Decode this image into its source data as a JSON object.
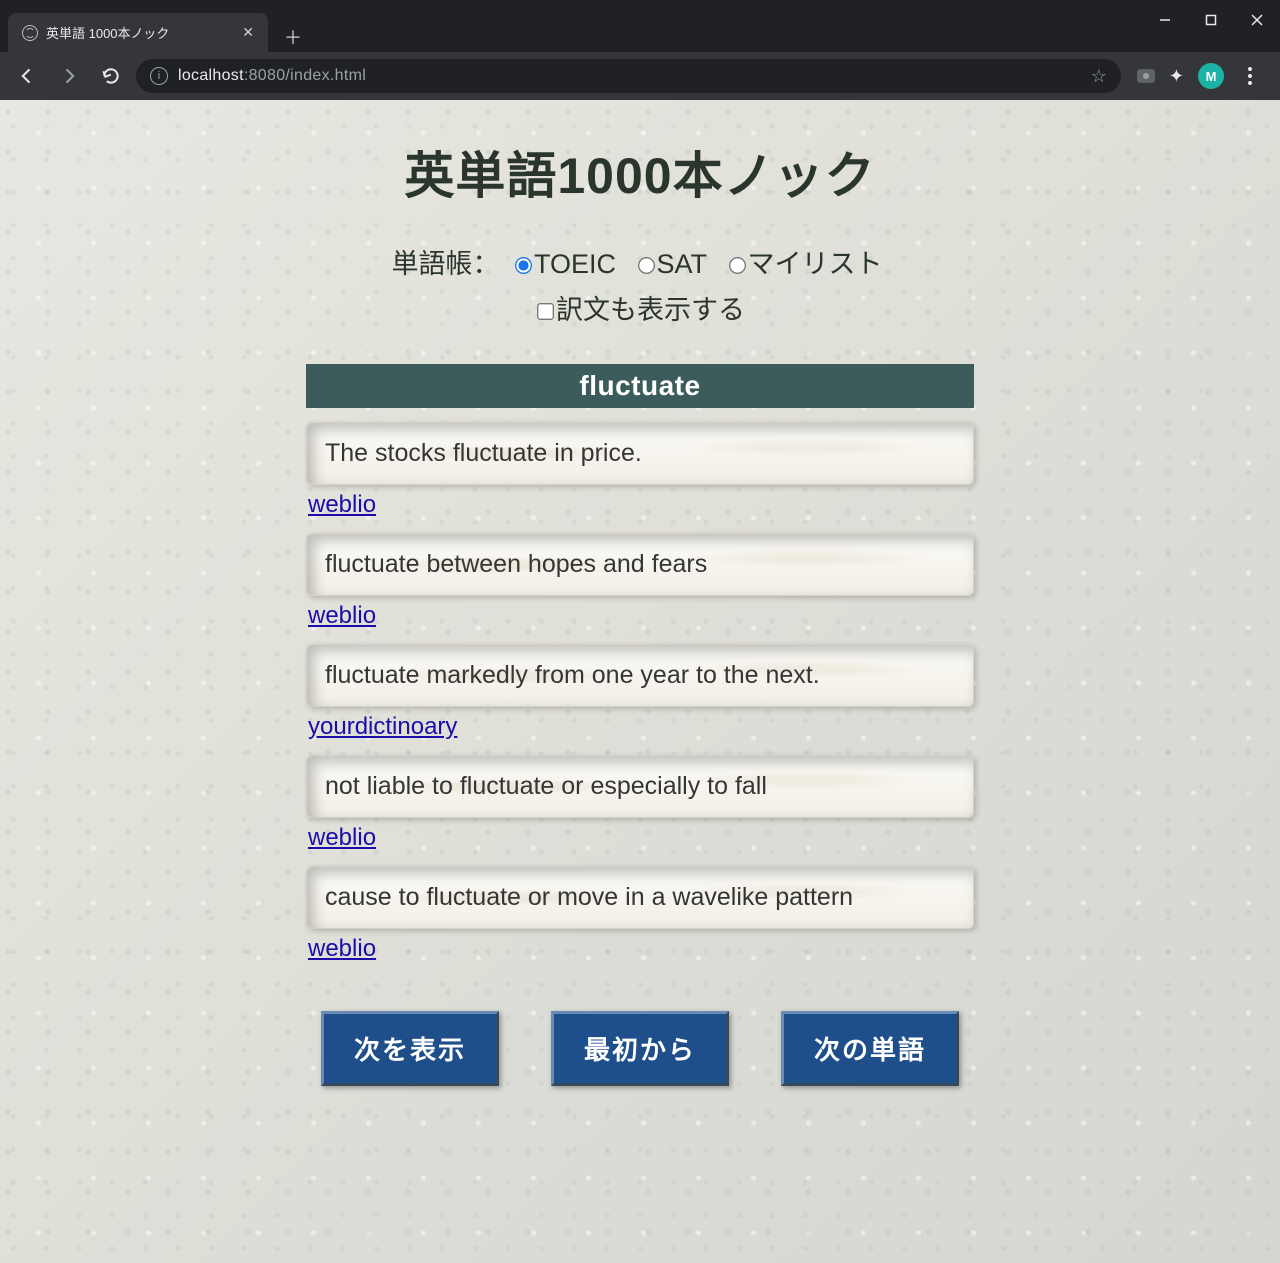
{
  "browser": {
    "tab_title": "英単語 1000本ノック",
    "url_host": "localhost",
    "url_port": ":8080",
    "url_path": "/index.html",
    "avatar_letter": "M"
  },
  "page": {
    "title": "英単語1000本ノック",
    "wordbook_label": "単語帳：",
    "options": {
      "toeic": "TOEIC",
      "sat": "SAT",
      "mylist": "マイリスト"
    },
    "selected_option": "toeic",
    "show_translation_label": "訳文も表示する",
    "show_translation_checked": false,
    "target_word": "fluctuate",
    "examples": [
      {
        "text": "The stocks fluctuate in price.",
        "source": "weblio"
      },
      {
        "text": "fluctuate between hopes and fears",
        "source": "weblio"
      },
      {
        "text": "fluctuate markedly from one year to the next.",
        "source": "yourdictinoary"
      },
      {
        "text": "not liable to fluctuate or especially to fall",
        "source": "weblio"
      },
      {
        "text": "cause to fluctuate or move in a wavelike pattern",
        "source": "weblio"
      }
    ],
    "buttons": {
      "next": "次を表示",
      "restart": "最初から",
      "next_word": "次の単語"
    }
  }
}
